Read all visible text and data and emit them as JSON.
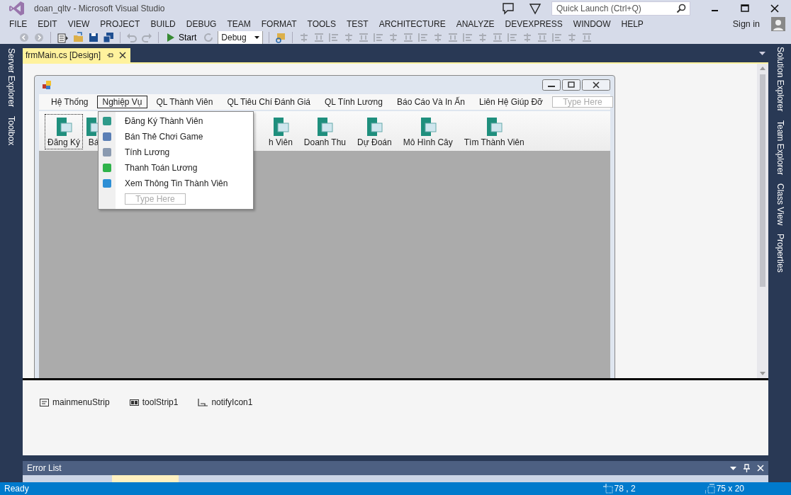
{
  "window": {
    "title": "doan_qltv - Microsoft Visual Studio"
  },
  "quick_launch": {
    "placeholder": "Quick Launch (Ctrl+Q)"
  },
  "menu": [
    "FILE",
    "EDIT",
    "VIEW",
    "PROJECT",
    "BUILD",
    "DEBUG",
    "TEAM",
    "FORMAT",
    "TOOLS",
    "TEST",
    "ARCHITECTURE",
    "ANALYZE",
    "DEVEXPRESS",
    "WINDOW",
    "HELP"
  ],
  "sign_in": "Sign in",
  "toolbar": {
    "start": "Start",
    "configuration": "Debug"
  },
  "left_tabs": [
    "Server Explorer",
    "Toolbox"
  ],
  "right_tabs": [
    "Solution Explorer",
    "Team Explorer",
    "Class View",
    "Properties"
  ],
  "document_tabs": [
    {
      "label": "frmMain.cs [Design]",
      "selected": true
    }
  ],
  "form": {
    "menu": [
      {
        "label": "Hệ Thống",
        "selected": false
      },
      {
        "label": "Nghiệp Vụ",
        "selected": true
      },
      {
        "label": "QL Thành Viên",
        "selected": false
      },
      {
        "label": "QL Tiêu Chí Đánh Giá",
        "selected": false
      },
      {
        "label": "QL Tính Lương",
        "selected": false
      },
      {
        "label": "Báo Cáo Và In Ấn",
        "selected": false
      },
      {
        "label": "Liên Hệ Giúp Đỡ",
        "selected": false
      }
    ],
    "menu_placeholder": "Type Here",
    "toolstrip": [
      {
        "label": "Đăng Ký",
        "selected": true
      },
      {
        "label": "Bá",
        "selected": false
      },
      {
        "label": "h Viên",
        "selected": false
      },
      {
        "label": "Doanh Thu",
        "selected": false
      },
      {
        "label": "Dự Đoán",
        "selected": false
      },
      {
        "label": "Mô Hình Cây",
        "selected": false
      },
      {
        "label": "Tìm Thành Viên",
        "selected": false
      }
    ],
    "dropdown": {
      "items": [
        {
          "label": "Đăng Ký Thành Viên",
          "color": "#2e9a8a"
        },
        {
          "label": "Bán Thẻ Chơi Game",
          "color": "#5a7fb5"
        },
        {
          "label": "Tính Lương",
          "color": "#8a9ab0"
        },
        {
          "label": "Thanh Toán Lương",
          "color": "#2fb34a"
        },
        {
          "label": "Xem Thông Tin Thành Viên",
          "color": "#2d8fd5"
        }
      ],
      "placeholder": "Type Here"
    }
  },
  "component_tray": [
    {
      "label": "mainmenuStrip",
      "kind": "menu"
    },
    {
      "label": "toolStrip1",
      "kind": "toolstrip"
    },
    {
      "label": "notifyIcon1",
      "kind": "notify"
    }
  ],
  "error_list": {
    "title": "Error List"
  },
  "status_bar": {
    "text": "Ready",
    "position": "78 , 2",
    "size": "75 x 20"
  }
}
